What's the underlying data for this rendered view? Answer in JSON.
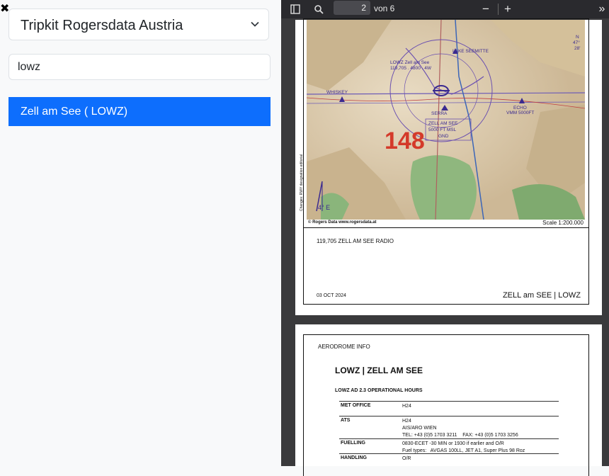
{
  "app": {
    "close_glyph": "✖"
  },
  "selector": {
    "value": "Tripkit Rogersdata Austria",
    "icon": "chevron-down-icon"
  },
  "search": {
    "value": "lowz"
  },
  "results": [
    {
      "label": "Zell am See ( LOWZ)"
    }
  ],
  "colors": {
    "accent": "#0d6efd",
    "viewer_bg": "#3a3a3c",
    "toolbar_bg": "#2a2a2e"
  },
  "pdf_toolbar": {
    "page_number": "2",
    "page_total": "von 6",
    "sidebar_icon": "sidebar-toggle-icon",
    "search_icon": "search-icon",
    "zoom_out": "−",
    "zoom_in": "+",
    "more": "»"
  },
  "page1": {
    "map_labels": {
      "lake_seemitte": "LAKE\nSEEMITTE",
      "lowz_freq": "LOWZ Zell am See",
      "freq": "119,705 . 4800 . 4W",
      "whiskey": "WHISKEY",
      "echo": "ECHO",
      "vmm": "VMM 5000FT",
      "zell_am_see_box": "ZELL AM SEE",
      "zell_box_alt": "5000 FT MSL",
      "zell_box_gnd": "GND",
      "serra": "SERRA",
      "elevation_mark": "148",
      "var": "4° E",
      "compass": "N",
      "lat": "47°",
      "lat_min": "28'",
      "side_note": "Changes: RWY designation editorial"
    },
    "copyright": "© Rogers Data    www.rogersdata.at",
    "scale": "Scale 1:200.000",
    "radio": "119,705  ZELL AM SEE RADIO",
    "date": "03 OCT 2024",
    "chart_id": "ZELL am SEE | LOWZ"
  },
  "page2": {
    "section": "AERODROME INFO",
    "title": "LOWZ  |  ZELL AM SEE",
    "subheading": "LOWZ AD 2.3    OPERATIONAL HOURS",
    "rows": [
      {
        "key": "MET OFFICE",
        "value": "H24"
      },
      {
        "key": "ATS",
        "value": "H24\nAIS/ARO WIEN\nTEL: +43 (0)5 1703 3211    FAX: +43 (0)5 1703 3256"
      },
      {
        "key": "FUELLING",
        "value": "0830-ECET -30 MIN or 1930 if earlier and O/R\nFuel types:   AVGAS 100LL, JET A1, Super Plus 98 Roz"
      },
      {
        "key": "HANDLING",
        "value": "O/R"
      }
    ]
  }
}
